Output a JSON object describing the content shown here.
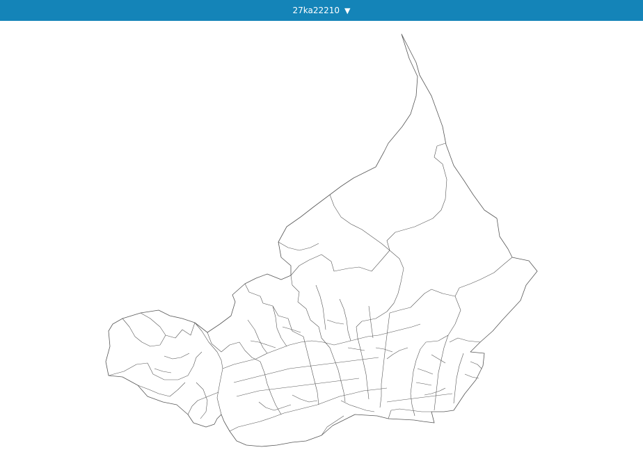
{
  "header": {
    "area_code": "27ka22210",
    "dropdown_icon": "triangle-down-icon",
    "background_color": "#1484b8"
  },
  "map": {
    "background_color": "#ffffff",
    "boundary_color": "#555555"
  }
}
